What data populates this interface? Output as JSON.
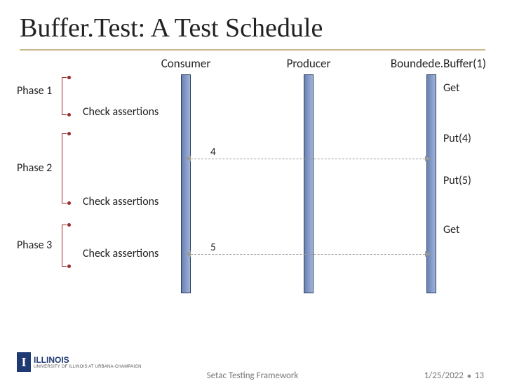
{
  "title": "Buffer.Test: A Test Schedule",
  "lanes": {
    "consumer": "Consumer",
    "producer": "Producer",
    "buffer": "Boundede.Buffer(1)"
  },
  "phases": {
    "p1": "Phase 1",
    "p2": "Phase 2",
    "p3": "Phase 3"
  },
  "check": "Check assertions",
  "events": {
    "get1": "Get",
    "put4": "Put(4)",
    "put5": "Put(5)",
    "get2": "Get"
  },
  "msg": {
    "four": "4",
    "five": "5"
  },
  "footer": {
    "center": "Setac Testing Framework",
    "date": "1/25/2022",
    "page": "13"
  },
  "logo": {
    "letter": "I",
    "name": "ILLINOIS",
    "sub": "UNIVERSITY OF ILLINOIS AT URBANA-CHAMPAIGN"
  },
  "chart_data": {
    "type": "table",
    "title": "Buffer.Test: A Test Schedule",
    "actors": [
      "Consumer",
      "Producer",
      "BoundedBuffer(1)"
    ],
    "phases": [
      {
        "name": "Phase 1",
        "events": [
          {
            "from": "BoundedBuffer(1)",
            "action": "Get"
          },
          {
            "action": "Check assertions"
          }
        ]
      },
      {
        "name": "Phase 2",
        "events": [
          {
            "from": "BoundedBuffer(1)",
            "action": "Put(4)"
          },
          {
            "from": "BoundedBuffer(1)",
            "to": "Consumer",
            "message": "4"
          },
          {
            "from": "BoundedBuffer(1)",
            "action": "Put(5)"
          },
          {
            "action": "Check assertions"
          }
        ]
      },
      {
        "name": "Phase 3",
        "events": [
          {
            "from": "BoundedBuffer(1)",
            "action": "Get"
          },
          {
            "from": "BoundedBuffer(1)",
            "to": "Consumer",
            "message": "5"
          },
          {
            "action": "Check assertions"
          }
        ]
      }
    ]
  }
}
